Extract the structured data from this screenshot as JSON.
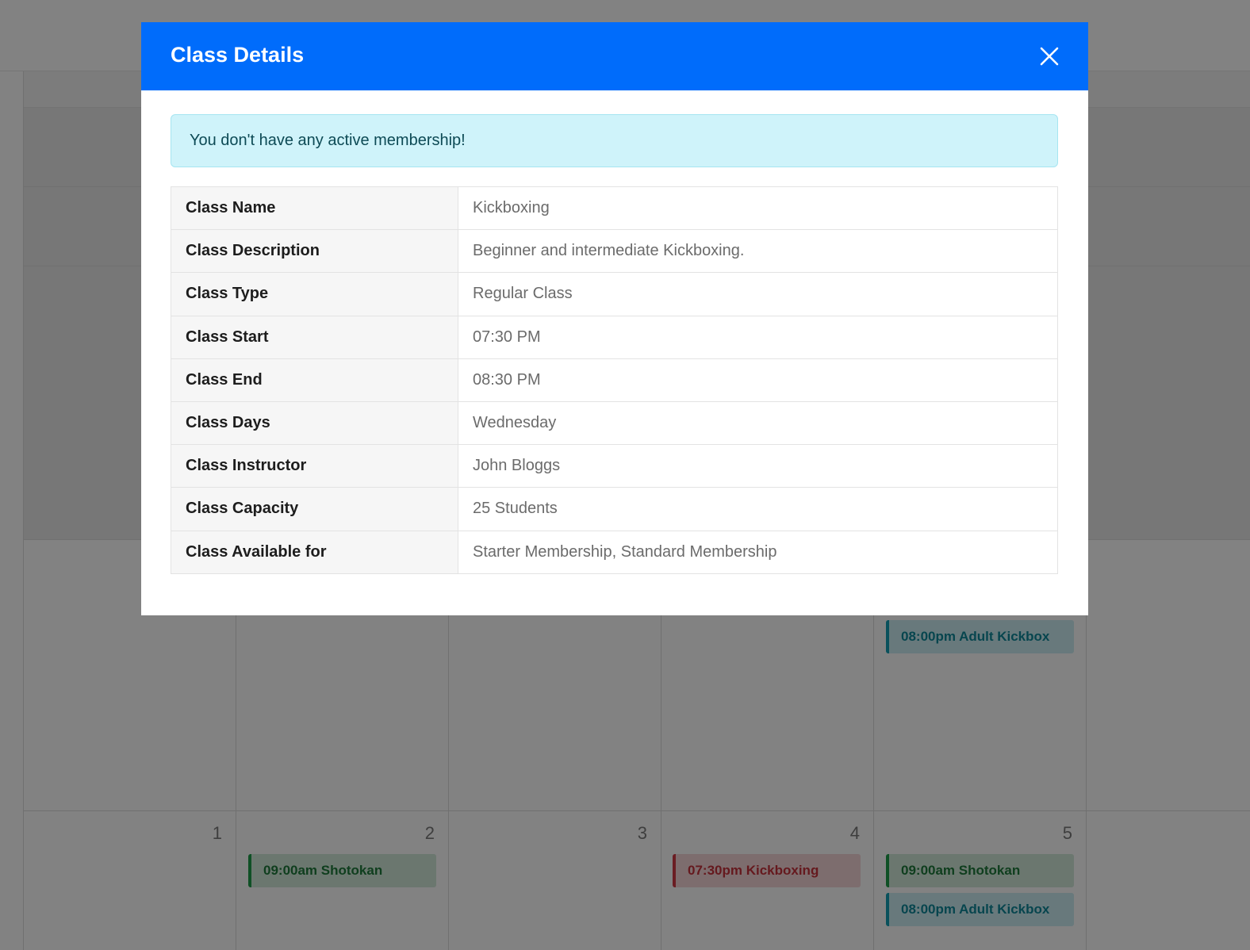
{
  "calendar": {
    "day_numbers": [
      "1",
      "2",
      "3",
      "4",
      "5"
    ],
    "events": {
      "upper_adult_kickbox": "08:00pm Adult Kickbox",
      "d2_shotokan": "09:00am Shotokan",
      "d4_kickboxing": "07:30pm Kickboxing",
      "d5_shotokan": "09:00am Shotokan",
      "d5_adult_kickbox": "08:00pm Adult Kickbox"
    }
  },
  "modal": {
    "title": "Class Details",
    "close_icon": "close-icon",
    "alert": "You don't have any active membership!",
    "rows": [
      {
        "label": "Class Name",
        "value": "Kickboxing"
      },
      {
        "label": "Class Description",
        "value": "Beginner and intermediate Kickboxing."
      },
      {
        "label": "Class Type",
        "value": "Regular Class"
      },
      {
        "label": "Class Start",
        "value": "07:30 PM"
      },
      {
        "label": "Class End",
        "value": "08:30 PM"
      },
      {
        "label": "Class Days",
        "value": "Wednesday"
      },
      {
        "label": "Class Instructor",
        "value": "John Bloggs"
      },
      {
        "label": "Class Capacity",
        "value": "25 Students"
      },
      {
        "label": "Class Available for",
        "value": "Starter Membership, Standard Membership"
      }
    ]
  },
  "colors": {
    "header_blue": "#006cfb",
    "alert_bg": "#cff3fa",
    "event_green": "#1f9d4a",
    "event_red": "#d33a45",
    "event_cyan": "#14a0b4"
  }
}
